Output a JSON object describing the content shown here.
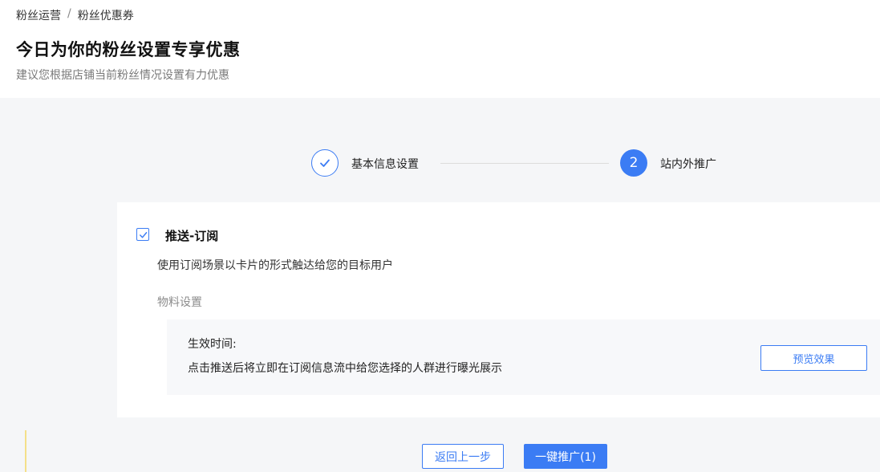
{
  "breadcrumb": {
    "parent": "粉丝运营",
    "separator": "/",
    "current": "粉丝优惠券"
  },
  "page": {
    "title": "今日为你的粉丝设置专享优惠",
    "subtitle": "建议您根据店铺当前粉丝情况设置有力优惠"
  },
  "stepper": {
    "steps": [
      {
        "label": "基本信息设置",
        "status": "done",
        "icon": "check-icon"
      },
      {
        "label": "站内外推广",
        "status": "current",
        "number": "2"
      }
    ]
  },
  "option": {
    "checked": true,
    "title": "推送-订阅",
    "description": "使用订阅场景以卡片的形式触达给您的目标用户",
    "material_label": "物料设置",
    "effective_time_label": "生效时间:",
    "effective_time_desc": "点击推送后将立即在订阅信息流中给您选择的人群进行曝光展示",
    "preview_label": "预览效果"
  },
  "footer": {
    "back_label": "返回上一步",
    "promote_label": "一键推广(1)"
  },
  "colors": {
    "accent": "#3b7cf4",
    "background": "#f5f6f8"
  }
}
